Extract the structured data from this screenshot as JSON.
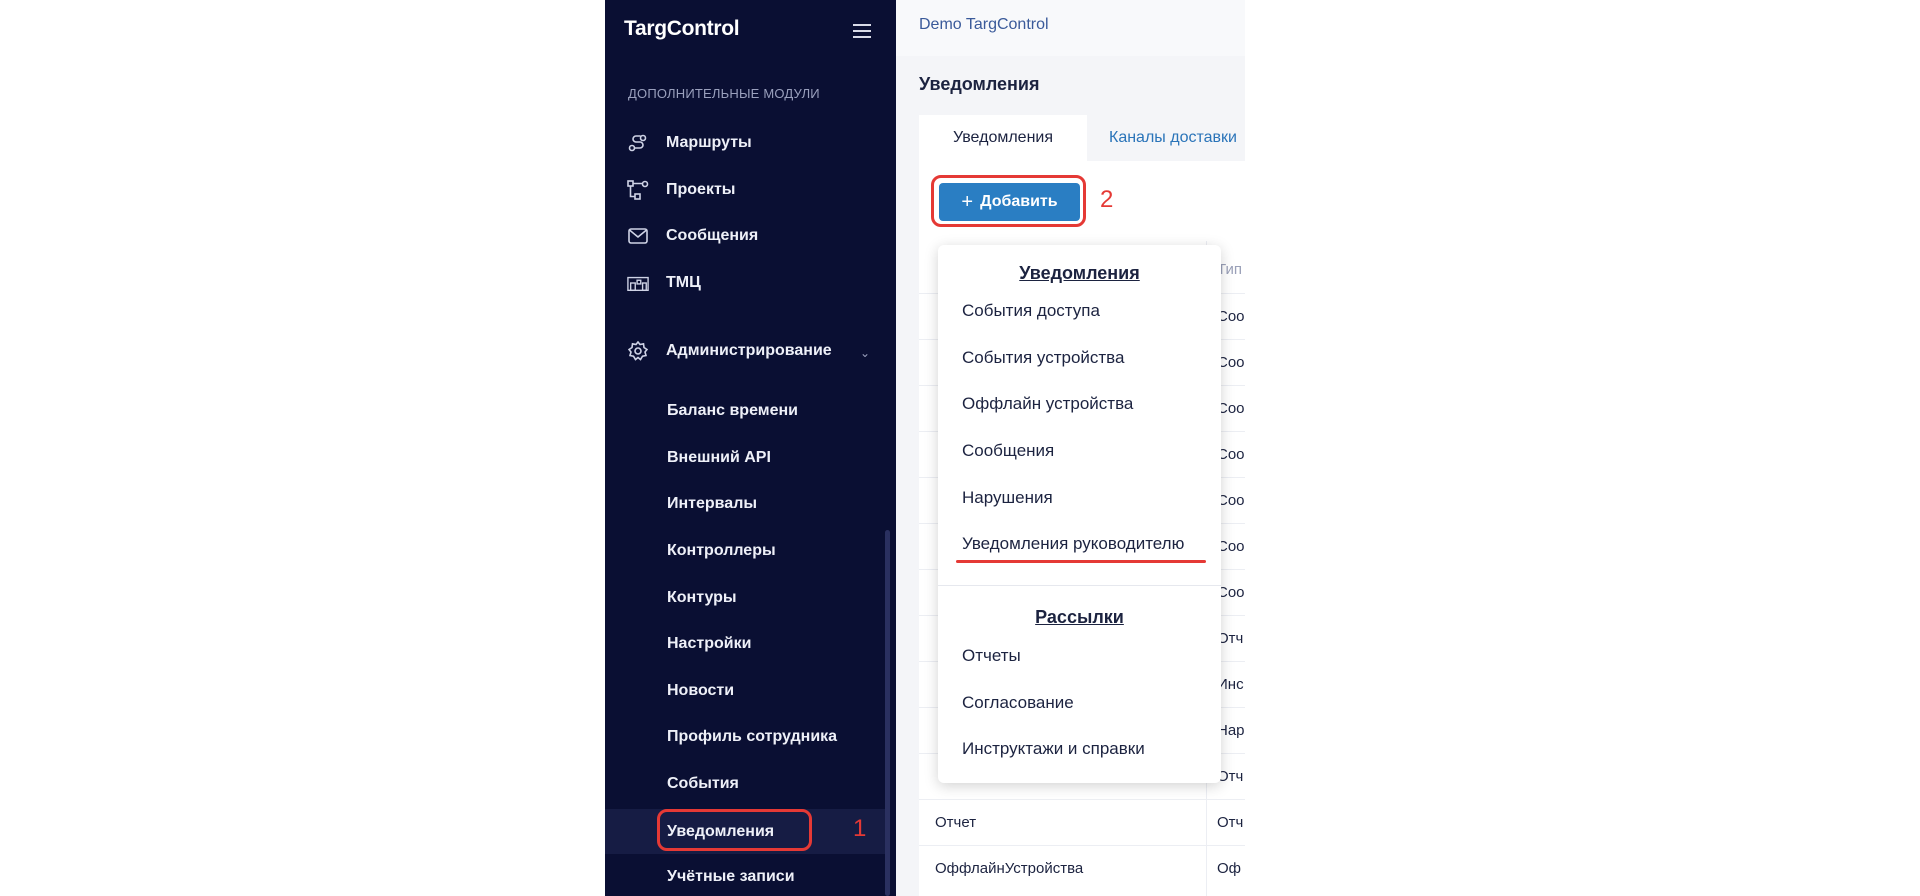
{
  "app": {
    "logo": "TargControl",
    "window_title": "Demo TargControl"
  },
  "sidebar": {
    "section_label": "ДОПОЛНИТЕЛЬНЫЕ МОДУЛИ",
    "items": [
      {
        "label": "Маршруты",
        "icon": "route-icon"
      },
      {
        "label": "Проекты",
        "icon": "projects-icon"
      },
      {
        "label": "Сообщения",
        "icon": "mail-icon"
      },
      {
        "label": "ТМЦ",
        "icon": "warehouse-icon"
      },
      {
        "label": "Администрирование",
        "icon": "gear-icon"
      }
    ],
    "admin_subitems": [
      "Баланс времени",
      "Внешний API",
      "Интервалы",
      "Контроллеры",
      "Контуры",
      "Настройки",
      "Новости",
      "Профиль сотрудника",
      "События",
      "Уведомления",
      "Учётные записи"
    ],
    "active_item": "Уведомления"
  },
  "main": {
    "page_title": "Уведомления",
    "tabs": [
      {
        "label": "Уведомления"
      },
      {
        "label": "Каналы доставки"
      }
    ],
    "add_button": "Добавить",
    "table": {
      "header_c2": "Тип",
      "rows": [
        {
          "c1": "",
          "c2": "Соо"
        },
        {
          "c1": "",
          "c2": "Соо"
        },
        {
          "c1": "",
          "c2": "Соо"
        },
        {
          "c1": "",
          "c2": "Соо"
        },
        {
          "c1": "",
          "c2": "Соо"
        },
        {
          "c1": "",
          "c2": "Соо"
        },
        {
          "c1": "",
          "c2": "Соо"
        },
        {
          "c1": "",
          "c2": "Отч"
        },
        {
          "c1": "",
          "c2": "Инс"
        },
        {
          "c1": "",
          "c2": "Нар"
        },
        {
          "c1": "",
          "c2": "Отч"
        },
        {
          "c1": "Отчет",
          "c2": "Отч"
        },
        {
          "c1": "ОффлайнУстройства",
          "c2": "Оф"
        }
      ]
    }
  },
  "dropdown": {
    "notifications_header": "Уведомления",
    "notifications": [
      "События доступа",
      "События устройства",
      "Оффлайн устройства",
      "Сообщения",
      "Нарушения",
      "Уведомления руководителю"
    ],
    "mailings_header": "Рассылки",
    "mailings": [
      "Отчеты",
      "Согласование",
      "Инструктажи и справки"
    ]
  },
  "annotations": {
    "step1": "1",
    "step2": "2"
  },
  "colors": {
    "sidebar_bg": "#0a0f33",
    "accent": "#2a7ec3",
    "highlight": "#e53935"
  }
}
